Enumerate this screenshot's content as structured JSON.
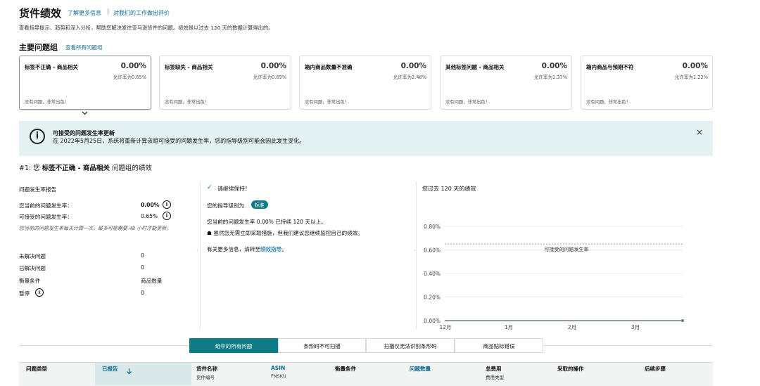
{
  "header": {
    "title": "货件绩效",
    "learn_more": "了解更多信息",
    "separator": "|",
    "feedback": "对我们的工作做出评价",
    "description": "查看指导提示、趋势和深入分析，帮助您解决发往亚马逊货件的问题。绩效是以过去 120 天的数据计算得出的。"
  },
  "issue_groups": {
    "title": "主要问题组",
    "view_all": "查看所有问题组",
    "cards": [
      {
        "name": "标签不正确 - 商品相关",
        "value": "0.00%",
        "allowed": "允许率为0.65%",
        "note": "没有问题，非常出色！"
      },
      {
        "name": "标签缺失 - 商品相关",
        "value": "0.00%",
        "allowed": "允许率为0.69%",
        "note": "没有问题，非常出色！"
      },
      {
        "name": "箱内商品数量不准确",
        "value": "0.00%",
        "allowed": "允许率为2.48%",
        "note": "没有问题，非常出色！"
      },
      {
        "name": "其他标签问题 - 商品相关",
        "value": "0.00%",
        "allowed": "允许率为1.37%",
        "note": "没有问题，非常出色！"
      },
      {
        "name": "箱内商品与预期不符",
        "value": "0.00%",
        "allowed": "允许率为1.22%",
        "note": "没有问题，非常出色！"
      }
    ]
  },
  "banner": {
    "icon": "info-icon",
    "title": "可接受的问题发生率更新",
    "text": "在 2022年5月25日，系统将重新计算该组可接受的问题发生率，您的指导级别可能会因此发生变化。",
    "close": "×"
  },
  "section": {
    "prefix": "#1: 您",
    "bold": "标签不正确 - 商品相关",
    "suffix": "问题组的绩效"
  },
  "report": {
    "title": "问题发生率报告",
    "current_label": "您当前的问题发生率：",
    "current_value": "0.00%",
    "acceptable_label": "可接受的问题发生率：",
    "acceptable_value": "0.65%",
    "note": "您当前的问题发生率每天计算一次，最多可能需要 48 小时才能更新。",
    "unresolved_label": "未解决问题",
    "unresolved_value": "0",
    "resolved_label": "已解决问题",
    "resolved_value": "0",
    "criteria_label": "衡量条件",
    "criteria_value": "商品数量",
    "paused_label": "暂停",
    "paused_value": "0"
  },
  "guidance": {
    "check": "✓",
    "keep": "请继续保持！",
    "level_label": "您的指导级别为",
    "level_badge": "标准",
    "line1": "您当前的问题发生率 0.00% 已持续 120 天以上。",
    "bullet": "虽然您无需立即采取措施，但我们建议您继续监控自己的绩效。",
    "more_prefix": "有关更多信息，请转至",
    "more_link": "绩效指导",
    "more_suffix": "。"
  },
  "chart_data": {
    "type": "line",
    "title": "您过去 120 天的绩效",
    "x": [
      "12月",
      "1月",
      "2月",
      "3月"
    ],
    "y_ticks": [
      "0.00%",
      "0.20%",
      "0.40%",
      "0.60%",
      "0.80%"
    ],
    "ylim": [
      0,
      0.8
    ],
    "series": [
      {
        "values": [
          0,
          0,
          0,
          0,
          0
        ]
      }
    ],
    "threshold": {
      "label": "可接受的问题发生率",
      "value": 0.65
    },
    "grid": true
  },
  "tabs": [
    {
      "label": "组中的所有问题",
      "active": true
    },
    {
      "label": "条形码不可扫描",
      "active": false
    },
    {
      "label": "扫描仪无法识别条形码",
      "active": false
    },
    {
      "label": "商品贴标错误",
      "active": false
    }
  ],
  "table": {
    "columns": [
      {
        "label": "问题类型",
        "sub": ""
      },
      {
        "label": "已报告",
        "sub": "",
        "sorted": true
      },
      {
        "label": "货件名称",
        "sub": "货件编号"
      },
      {
        "label": "ASIN",
        "sub": "FNSKU"
      },
      {
        "label": "衡量条件",
        "sub": ""
      },
      {
        "label": "问题数量",
        "sub": ""
      },
      {
        "label": "总费用",
        "sub": "费用类型"
      },
      {
        "label": "采取的操作",
        "sub": ""
      },
      {
        "label": "后续步骤",
        "sub": ""
      }
    ],
    "sort_icon": "sort-down-icon"
  },
  "colors": {
    "accent": "#0e7c86",
    "link": "#0f6b8f",
    "banner_bg": "#e3f1f2"
  }
}
